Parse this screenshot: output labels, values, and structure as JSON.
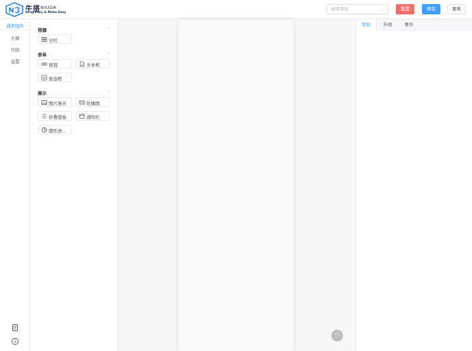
{
  "header": {
    "brand_cn": "牛搭",
    "brand_en": "NIUDA",
    "slogan": "Drag Easy & Make Easy",
    "preset_placeholder": "选择预设",
    "reset_label": "重置",
    "preview_label": "预览",
    "publish_label": "发布"
  },
  "sidebar": {
    "items": [
      {
        "label": "通用组件"
      },
      {
        "label": "大纲"
      },
      {
        "label": "代码"
      },
      {
        "label": "设置"
      }
    ],
    "bottom_icons": [
      "document-icon",
      "info-icon"
    ]
  },
  "panel": {
    "groups": [
      {
        "title": "容器",
        "items": [
          {
            "label": "分栏",
            "icon": "columns-icon"
          }
        ]
      },
      {
        "title": "表单",
        "items": [
          {
            "label": "按钮",
            "icon": "button-icon"
          },
          {
            "label": "文本框",
            "icon": "textbox-icon"
          },
          {
            "label": "复选框",
            "icon": "checkbox-icon"
          }
        ]
      },
      {
        "title": "展示",
        "items": [
          {
            "label": "图片展示",
            "icon": "image-icon"
          },
          {
            "label": "轮播图",
            "icon": "carousel-icon"
          },
          {
            "label": "折叠面板",
            "icon": "collapse-icon"
          },
          {
            "label": "通知栏",
            "icon": "notice-icon"
          },
          {
            "label": "圆形进...",
            "icon": "circle-progress-icon"
          }
        ]
      }
    ]
  },
  "right_panel": {
    "tabs": [
      {
        "label": "常规"
      },
      {
        "label": "外观"
      },
      {
        "label": "事件"
      }
    ]
  },
  "colors": {
    "accent": "#409eff",
    "danger": "#f56c6c",
    "brand_dark": "#1c2a44"
  }
}
